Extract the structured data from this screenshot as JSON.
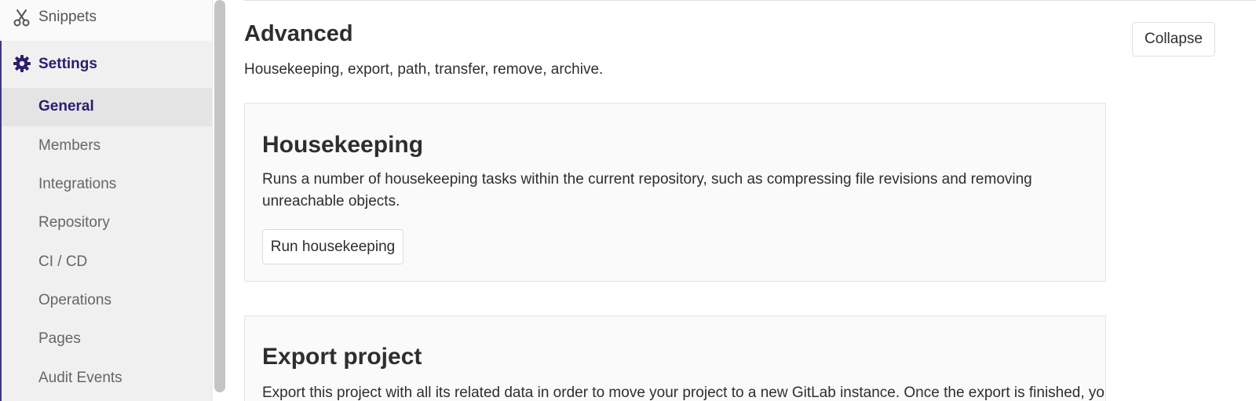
{
  "sidebar": {
    "top_item": {
      "label": "Snippets",
      "icon": "scissors-icon"
    },
    "settings": {
      "label": "Settings",
      "icon": "gear-icon",
      "items": [
        {
          "label": "General",
          "active": true
        },
        {
          "label": "Members"
        },
        {
          "label": "Integrations"
        },
        {
          "label": "Repository"
        },
        {
          "label": "CI / CD"
        },
        {
          "label": "Operations"
        },
        {
          "label": "Pages"
        },
        {
          "label": "Audit Events"
        }
      ]
    }
  },
  "main": {
    "section": {
      "title": "Advanced",
      "description": "Housekeeping, export, path, transfer, remove, archive.",
      "collapse_label": "Collapse"
    },
    "housekeeping": {
      "title": "Housekeeping",
      "description": "Runs a number of housekeeping tasks within the current repository, such as compressing file revisions and removing unreachable objects.",
      "button_label": "Run housekeeping"
    },
    "export": {
      "title": "Export project",
      "description": "Export this project with all its related data in order to move your project to a new GitLab instance. Once the export is finished, you"
    }
  },
  "colors": {
    "accent": "#28206f",
    "active_border": "#3b3787",
    "card_bg": "#fafafa",
    "sidebar_bg": "#f0f0f0"
  }
}
